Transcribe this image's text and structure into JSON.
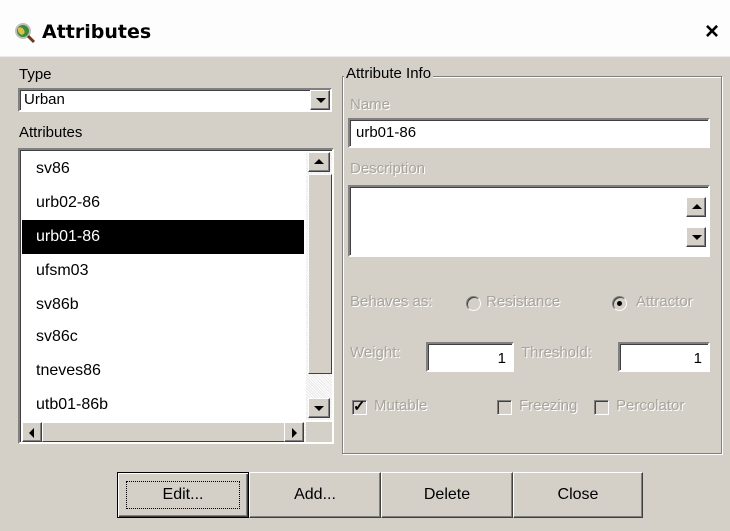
{
  "window": {
    "title": "Attributes",
    "close_glyph": "×",
    "icon": "globe-magnifier-icon"
  },
  "type_section": {
    "label": "Type",
    "selected": "Urban"
  },
  "attributes_section": {
    "label": "Attributes",
    "items": [
      "sv86",
      "urb02-86",
      "urb01-86",
      "ufsm03",
      "sv86b",
      "sv86c",
      "tneves86",
      "utb01-86b"
    ],
    "selected_index": 2
  },
  "attribute_info": {
    "group_label": "Attribute Info",
    "name_label": "Name",
    "name_value": "urb01-86",
    "description_label": "Description",
    "description_value": "",
    "behaves_label": "Behaves as:",
    "resistance_label": "Resistance",
    "attractor_label": "Attractor",
    "behaves_selected": "Attractor",
    "weight_label": "Weight:",
    "weight_value": "1",
    "threshold_label": "Threshold:",
    "threshold_value": "1",
    "mutable_label": "Mutable",
    "mutable_checked": true,
    "freezing_label": "Freezing",
    "freezing_checked": false,
    "percolator_label": "Percolator",
    "percolator_checked": false
  },
  "buttons": {
    "edit": "Edit...",
    "add": "Add...",
    "delete": "Delete",
    "close": "Close"
  },
  "colors": {
    "face": "#d4d0c8",
    "selection": "#000000",
    "disabled_text": "#a8a49c"
  }
}
